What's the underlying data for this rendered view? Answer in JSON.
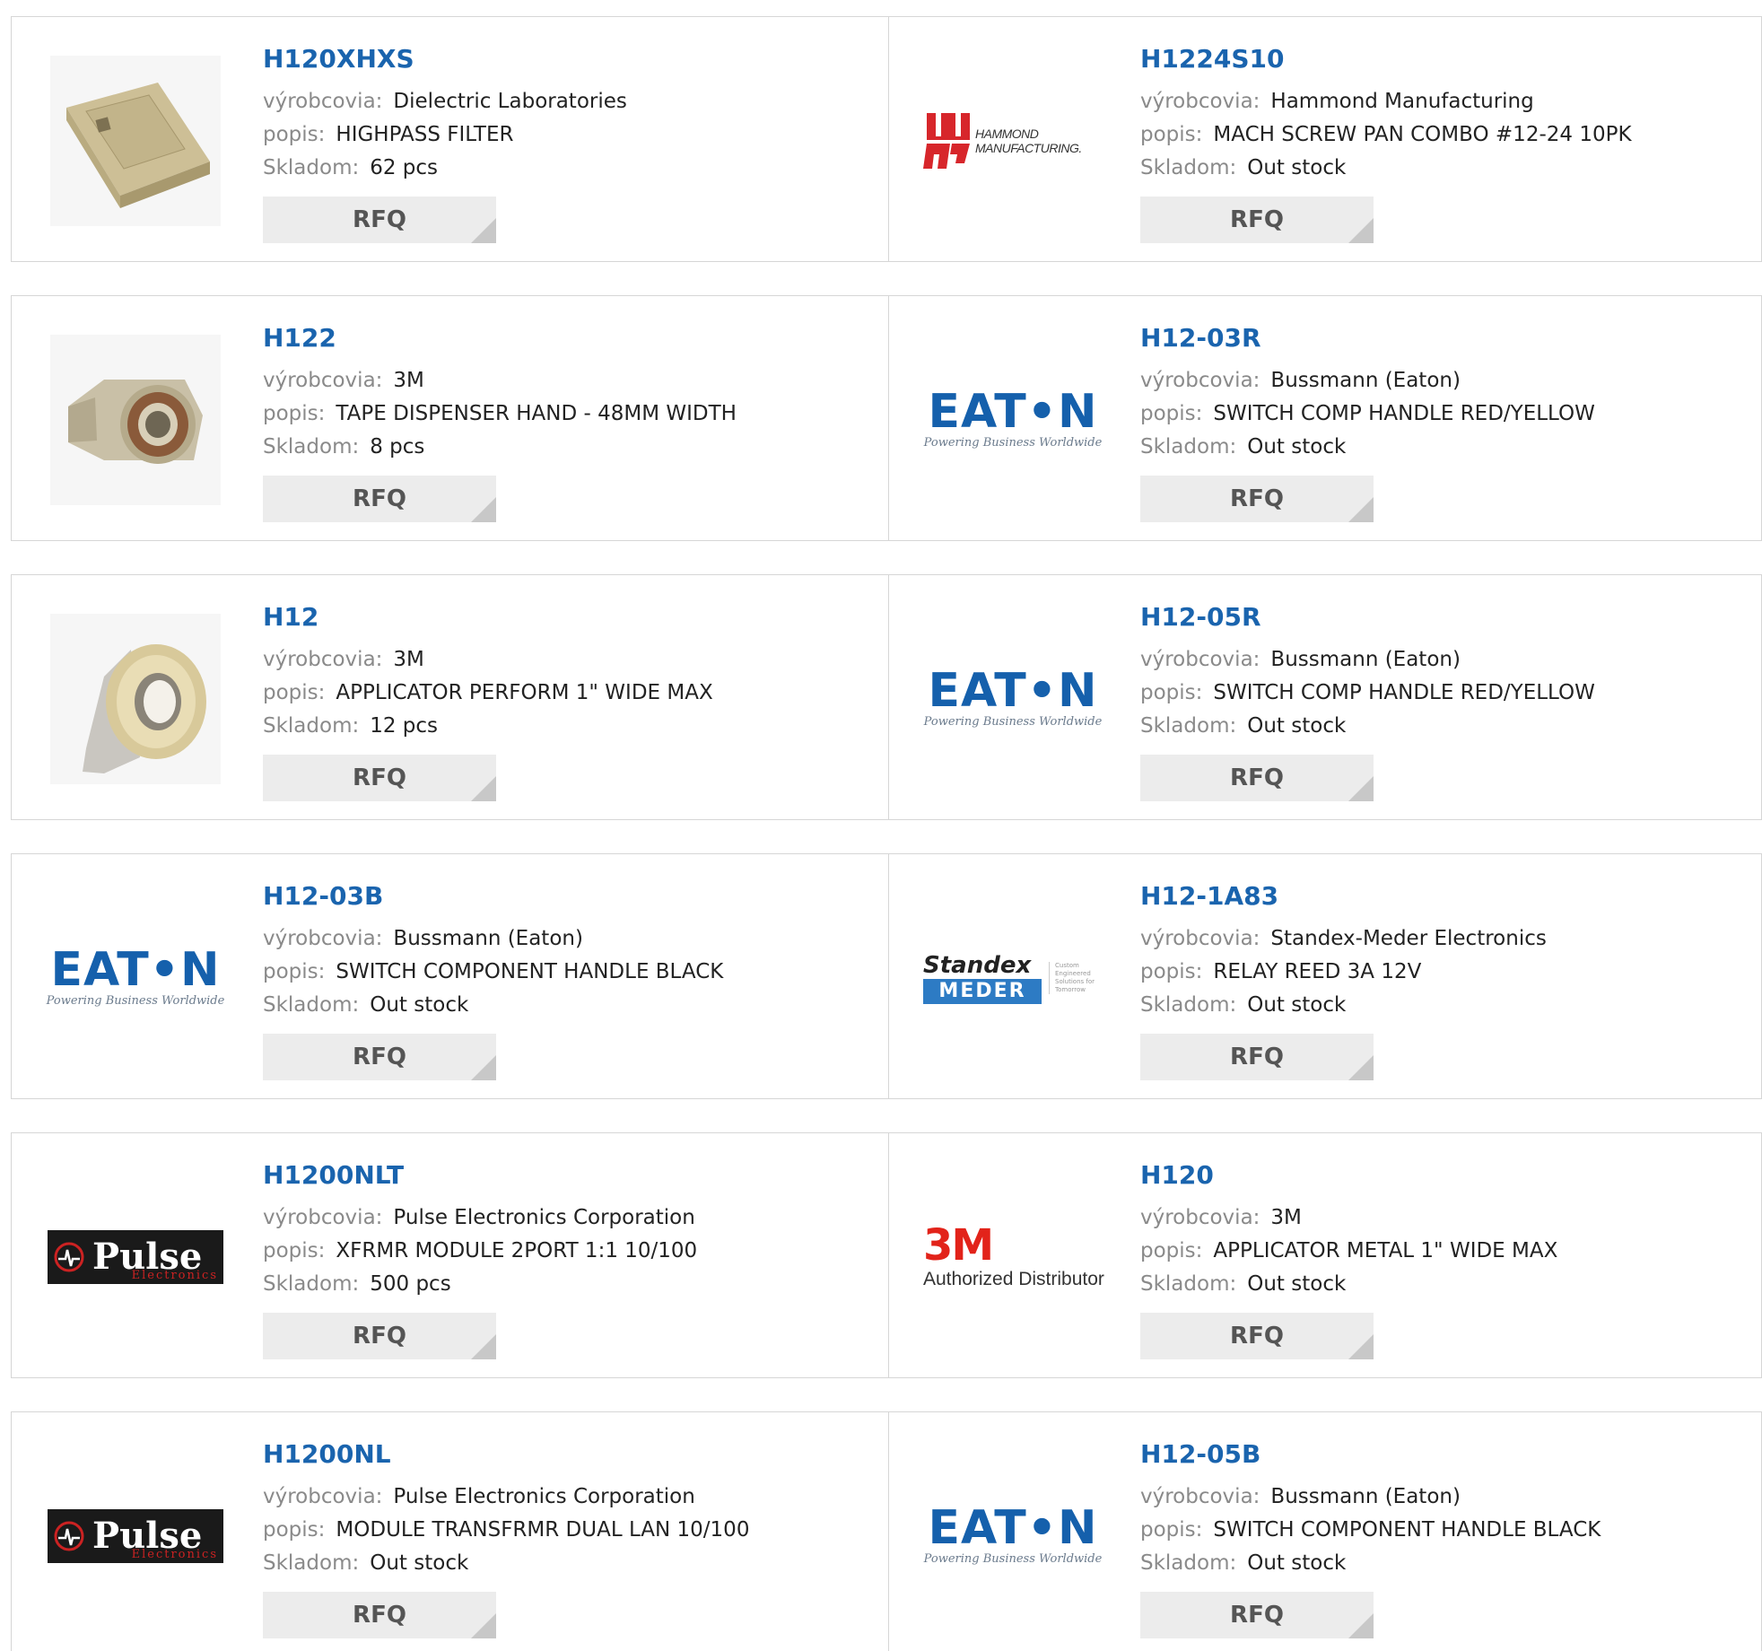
{
  "labels": {
    "manufacturer": "výrobcovia:",
    "description": "popis:",
    "stock": "Skladom:",
    "rfq": "RFQ"
  },
  "logos": {
    "eaton": {
      "word": "EAT•N",
      "tagline": "Powering Business Worldwide"
    },
    "pulse": {
      "word": "Pulse",
      "sub": "Electronics"
    },
    "m3": {
      "word": "3M",
      "sub": "Authorized Distributor"
    },
    "hammond": {
      "line1": "HAMMOND",
      "line2": "MANUFACTURING."
    },
    "standex": {
      "word": "Standex",
      "meder": "MEDER",
      "side": "Custom Engineered Solutions for Tomorrow"
    }
  },
  "products": [
    {
      "part": "H120XHXS",
      "manufacturer": "Dielectric Laboratories",
      "description": "HIGHPASS FILTER",
      "stock": "62 pcs",
      "image": "filter-component-image"
    },
    {
      "part": "H1224S10",
      "manufacturer": "Hammond Manufacturing",
      "description": "MACH SCREW PAN COMBO #12-24 10PK",
      "stock": "Out stock",
      "image": "hammond-logo"
    },
    {
      "part": "H122",
      "manufacturer": "3M",
      "description": "TAPE DISPENSER HAND - 48MM WIDTH",
      "stock": "8 pcs",
      "image": "tape-dispenser-image"
    },
    {
      "part": "H12-03R",
      "manufacturer": "Bussmann (Eaton)",
      "description": "SWITCH COMP HANDLE RED/YELLOW",
      "stock": "Out stock",
      "image": "eaton-logo"
    },
    {
      "part": "H12",
      "manufacturer": "3M",
      "description": "APPLICATOR PERFORM 1\" WIDE MAX",
      "stock": "12 pcs",
      "image": "tape-applicator-image"
    },
    {
      "part": "H12-05R",
      "manufacturer": "Bussmann (Eaton)",
      "description": "SWITCH COMP HANDLE RED/YELLOW",
      "stock": "Out stock",
      "image": "eaton-logo"
    },
    {
      "part": "H12-03B",
      "manufacturer": "Bussmann (Eaton)",
      "description": "SWITCH COMPONENT HANDLE BLACK",
      "stock": "Out stock",
      "image": "eaton-logo"
    },
    {
      "part": "H12-1A83",
      "manufacturer": "Standex-Meder Electronics",
      "description": "RELAY REED 3A 12V",
      "stock": "Out stock",
      "image": "standex-meder-logo"
    },
    {
      "part": "H1200NLT",
      "manufacturer": "Pulse Electronics Corporation",
      "description": "XFRMR MODULE 2PORT 1:1 10/100",
      "stock": "500 pcs",
      "image": "pulse-logo"
    },
    {
      "part": "H120",
      "manufacturer": "3M",
      "description": "APPLICATOR METAL 1\" WIDE MAX",
      "stock": "Out stock",
      "image": "3m-logo"
    },
    {
      "part": "H1200NL",
      "manufacturer": "Pulse Electronics Corporation",
      "description": "MODULE TRANSFRMR DUAL LAN 10/100",
      "stock": "Out stock",
      "image": "pulse-logo"
    },
    {
      "part": "H12-05B",
      "manufacturer": "Bussmann (Eaton)",
      "description": "SWITCH COMPONENT HANDLE BLACK",
      "stock": "Out stock",
      "image": "eaton-logo"
    }
  ],
  "colors": {
    "link": "#1a64ae",
    "label": "#8a8a8a",
    "button_bg": "#ececec",
    "border": "#d6d6d6"
  }
}
